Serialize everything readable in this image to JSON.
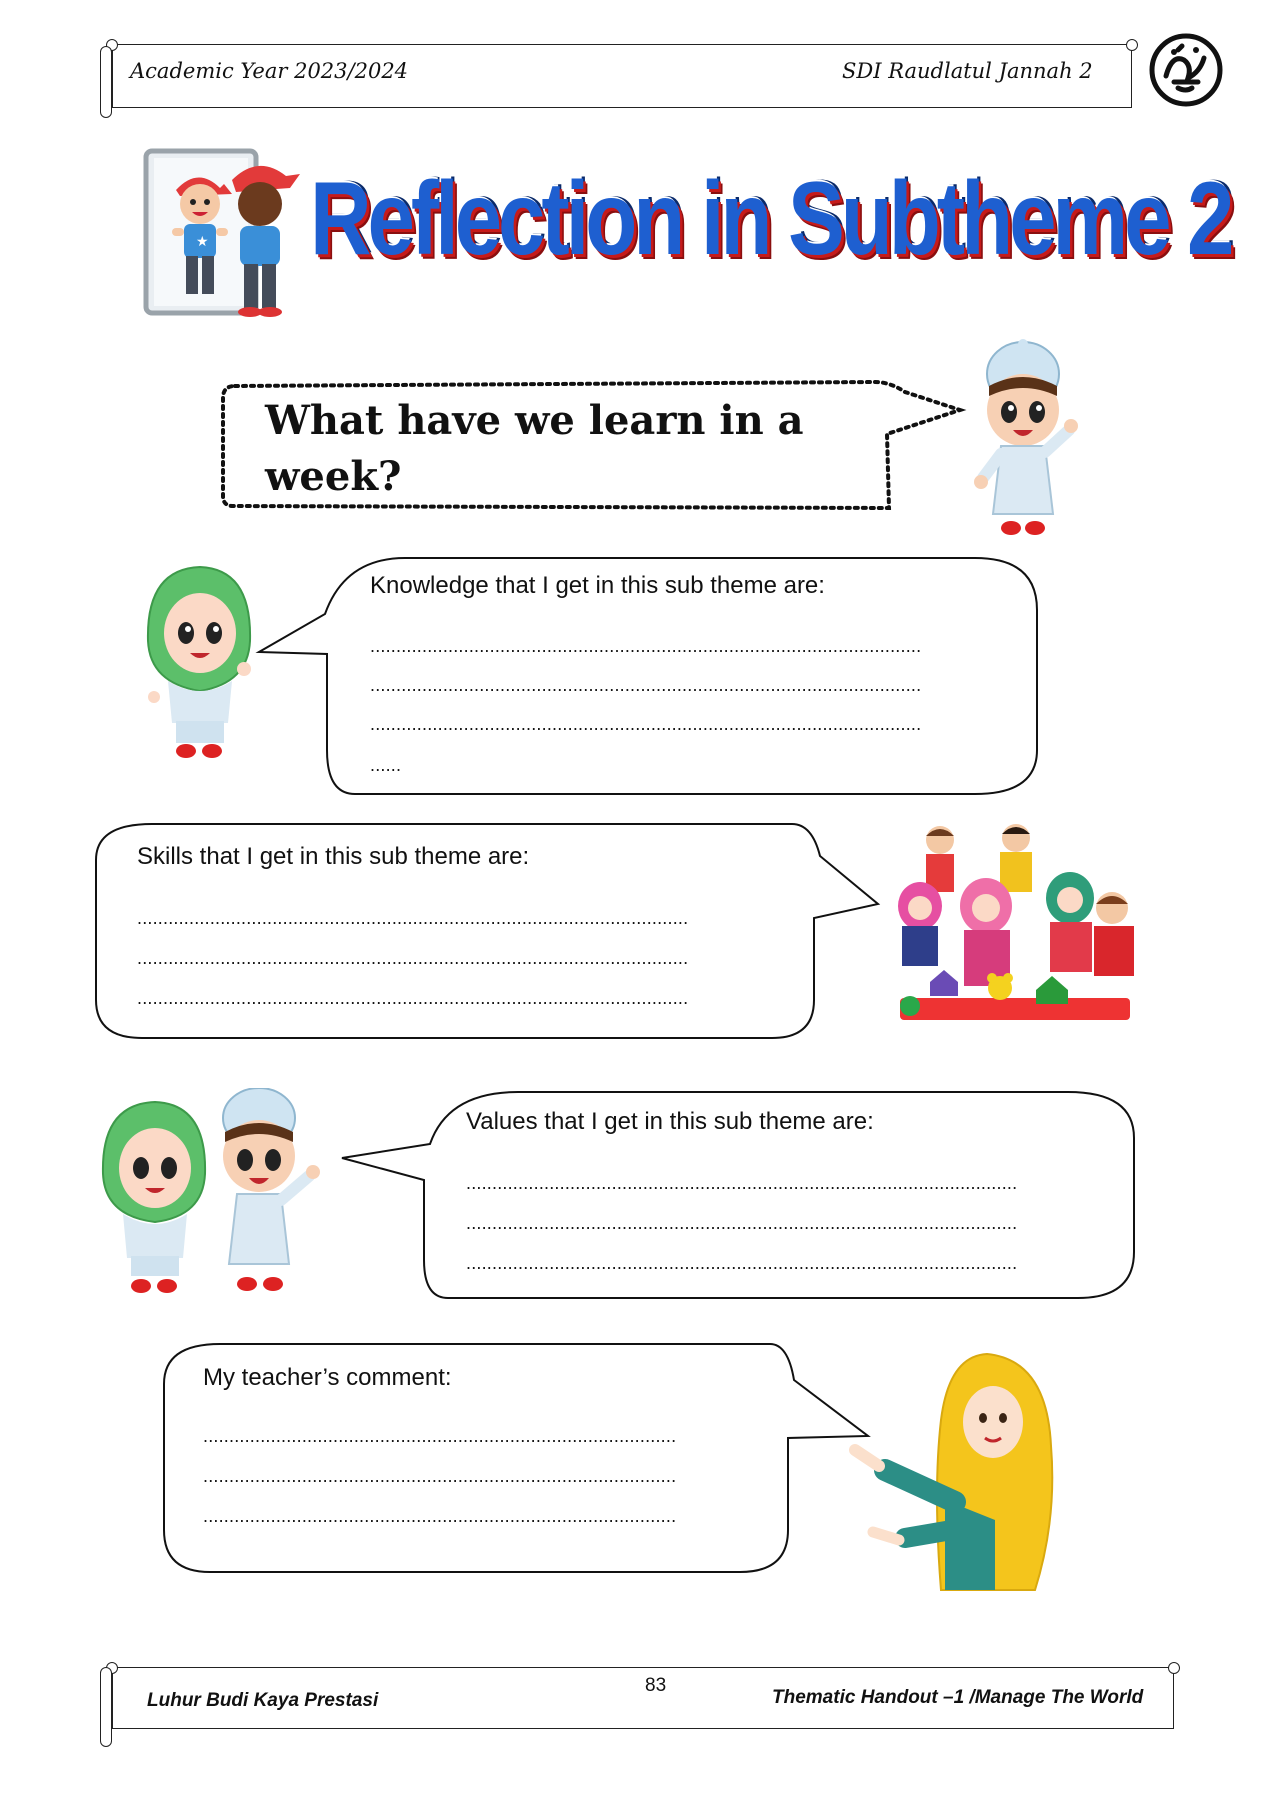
{
  "header": {
    "academic_year": "Academic Year 2023/2024",
    "school": "SDI  Raudlatul Jannah 2"
  },
  "title": "Reflection in Subtheme 2",
  "question": "What have we learn in a week?",
  "sections": {
    "knowledge": {
      "label": "Knowledge that I get in this sub theme are:",
      "lines": [
        "..........................................................................................................",
        "..........................................................................................................",
        "..........................................................................................................",
        "......"
      ]
    },
    "skills": {
      "label": "Skills that I get in this sub theme are:",
      "lines": [
        "..........................................................................................................",
        "..........................................................................................................",
        ".........................................................................................................."
      ]
    },
    "values": {
      "label": "Values that I get in this sub theme are:",
      "lines": [
        "..........................................................................................................",
        "..........................................................................................................",
        ".........................................................................................................."
      ]
    },
    "teacher": {
      "label": "My teacher’s comment:",
      "lines": [
        "...........................................................................................",
        "...........................................................................................",
        "..........................................................................................."
      ]
    }
  },
  "footer": {
    "motto": "Luhur Budi Kaya Prestasi",
    "page_number": "83",
    "handout": "Thematic Handout –1 /Manage The World"
  }
}
